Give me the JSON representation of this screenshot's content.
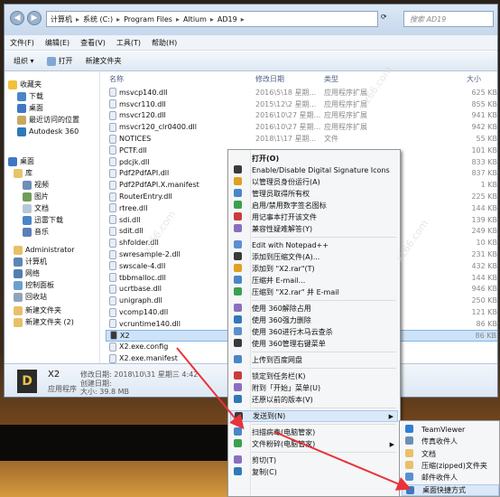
{
  "breadcrumb": {
    "items": [
      "计算机",
      "系统 (C:)",
      "Program Files",
      "Altium",
      "AD19"
    ]
  },
  "search": {
    "placeholder": "搜索 AD19"
  },
  "menubar": [
    "文件(F)",
    "编辑(E)",
    "查看(V)",
    "工具(T)",
    "帮助(H)"
  ],
  "toolbar": {
    "organize": "组织 ▾",
    "open": "打开",
    "new_folder": "新建文件夹"
  },
  "columns": {
    "name": "名称",
    "date": "修改日期",
    "type": "类型",
    "size": "大小"
  },
  "nav": {
    "favorites": "收藏夹",
    "downloads": "下载",
    "desktop": "桌面",
    "recent": "最近访问的位置",
    "autodesk": "Autodesk 360",
    "desktop2": "桌面",
    "libraries": "库",
    "videos": "视频",
    "pictures": "图片",
    "documents": "文档",
    "thunder": "迅雷下载",
    "music": "音乐",
    "admin": "Administrator",
    "computer": "计算机",
    "network": "网络",
    "control_panel": "控制面板",
    "recycle": "回收站",
    "new_folder": "新建文件夹",
    "new_folder2": "新建文件夹 (2)"
  },
  "files": [
    {
      "name": "msvcp140.dll",
      "date": "2016\\5\\18 星期...",
      "type": "应用程序扩展",
      "size": "625 KB"
    },
    {
      "name": "msvcr110.dll",
      "date": "2015\\12\\2 星期...",
      "type": "应用程序扩展",
      "size": "855 KB"
    },
    {
      "name": "msvcr120.dll",
      "date": "2016\\10\\27 星期...",
      "type": "应用程序扩展",
      "size": "941 KB"
    },
    {
      "name": "msvcr120_clr0400.dll",
      "date": "2016\\10\\27 星期...",
      "type": "应用程序扩展",
      "size": "942 KB"
    },
    {
      "name": "NOTICES",
      "date": "2018\\1\\17 星期...",
      "type": "文件",
      "size": "55 KB"
    },
    {
      "name": "PCTF.dll",
      "date": "",
      "type": "",
      "size": "101 KB"
    },
    {
      "name": "pdcjk.dll",
      "date": "",
      "type": "",
      "size": "833 KB"
    },
    {
      "name": "Pdf2PdfAPI.dll",
      "date": "",
      "type": "",
      "size": "837 KB"
    },
    {
      "name": "Pdf2PdfAPI.X.manifest",
      "date": "",
      "type": "",
      "size": "1 KB"
    },
    {
      "name": "RouterEntry.dll",
      "date": "",
      "type": "",
      "size": "225 KB"
    },
    {
      "name": "rtree.dll",
      "date": "",
      "type": "",
      "size": "144 KB"
    },
    {
      "name": "sdi.dll",
      "date": "",
      "type": "",
      "size": "139 KB"
    },
    {
      "name": "sdit.dll",
      "date": "",
      "type": "",
      "size": "249 KB"
    },
    {
      "name": "shfolder.dll",
      "date": "",
      "type": "",
      "size": "10 KB"
    },
    {
      "name": "swresample-2.dll",
      "date": "",
      "type": "",
      "size": "231 KB"
    },
    {
      "name": "swscale-4.dll",
      "date": "",
      "type": "",
      "size": "432 KB"
    },
    {
      "name": "tbbmalloc.dll",
      "date": "",
      "type": "",
      "size": "144 KB"
    },
    {
      "name": "ucrtbase.dll",
      "date": "",
      "type": "",
      "size": "946 KB"
    },
    {
      "name": "unigraph.dll",
      "date": "",
      "type": "",
      "size": "250 KB"
    },
    {
      "name": "vcomp140.dll",
      "date": "",
      "type": "",
      "size": "121 KB"
    },
    {
      "name": "vcruntime140.dll",
      "date": "",
      "type": "",
      "size": "86 KB"
    },
    {
      "name": "X2",
      "date": "",
      "type": "",
      "size": "86 KB"
    },
    {
      "name": "X2.exe.config",
      "date": "",
      "type": "",
      "size": ""
    },
    {
      "name": "X2.exe.manifest",
      "date": "",
      "type": "",
      "size": ""
    }
  ],
  "details": {
    "name": "X2",
    "kind": "应用程序",
    "modified": "修改日期: 2018\\10\\31 星期三 4:42",
    "created": "创建日期:",
    "size": "大小: 39.8 MB"
  },
  "context_menu": [
    {
      "label": "打开(O)",
      "bold": true
    },
    {
      "label": "Enable/Disable Digital Signature Icons"
    },
    {
      "label": "以管理员身份运行(A)"
    },
    {
      "label": "管理员取得所有权"
    },
    {
      "label": "启用/禁用数字签名图标"
    },
    {
      "label": "用记事本打开该文件"
    },
    {
      "label": "兼容性疑难解答(Y)"
    },
    {
      "sep": true
    },
    {
      "label": "Edit with Notepad++"
    },
    {
      "label": "添加到压缩文件(A)..."
    },
    {
      "label": "添加到 \"X2.rar\"(T)"
    },
    {
      "label": "压缩并 E-mail..."
    },
    {
      "label": "压缩到 \"X2.rar\" 并 E-mail"
    },
    {
      "sep": true
    },
    {
      "label": "使用 360解除占用"
    },
    {
      "label": "使用 360强力删除"
    },
    {
      "label": "使用 360进行木马云查杀"
    },
    {
      "label": "使用 360管理右键菜单"
    },
    {
      "sep": true
    },
    {
      "label": "上传到百度网盘"
    },
    {
      "sep": true
    },
    {
      "label": "锁定到任务栏(K)"
    },
    {
      "label": "附到「开始」菜单(U)"
    },
    {
      "label": "还原以前的版本(V)"
    },
    {
      "sep": true
    },
    {
      "label": "发送到(N)",
      "submenu": true,
      "highlight": true
    },
    {
      "sep": true
    },
    {
      "label": "扫描病毒(电脑管家)"
    },
    {
      "label": "文件粉碎(电脑管家)",
      "submenu": true
    },
    {
      "sep": true
    },
    {
      "label": "剪切(T)"
    },
    {
      "label": "复制(C)"
    }
  ],
  "send_to": [
    {
      "label": "TeamViewer"
    },
    {
      "label": "传真收件人"
    },
    {
      "label": "文档"
    },
    {
      "label": "压缩(zipped)文件夹"
    },
    {
      "label": "邮件收件人"
    },
    {
      "label": "桌面快捷方式",
      "highlight": true
    }
  ],
  "colors": {
    "accent": "#dbe8f7",
    "arrow": "#e8333a",
    "selected_row": "#cde3f7"
  }
}
